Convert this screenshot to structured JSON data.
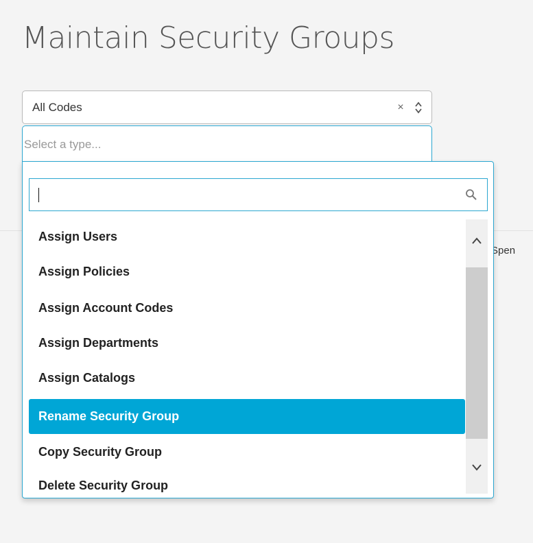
{
  "page": {
    "title": "Maintain Security Groups",
    "behind_text": "Spen"
  },
  "code_select": {
    "value": "All Codes",
    "clear_glyph": "×",
    "icons": [
      "clear-icon",
      "updown-arrows-icon"
    ]
  },
  "type_select": {
    "placeholder": "Select a type..."
  },
  "dropdown": {
    "search": {
      "value": "",
      "icon": "search-icon"
    },
    "options": [
      {
        "label": "Assign Users"
      },
      {
        "label": "Assign Policies"
      },
      {
        "label": "Assign Account Codes"
      },
      {
        "label": "Assign Departments"
      },
      {
        "label": "Assign Catalogs"
      },
      {
        "label": "Rename Security Group",
        "selected": true
      },
      {
        "label": "Copy Security Group"
      },
      {
        "label": "Delete Security Group"
      }
    ],
    "scrollbar": {
      "icons": [
        "chevron-up-icon",
        "chevron-down-icon"
      ]
    }
  },
  "colors": {
    "accent": "#00a6d6",
    "focus_border": "#2aa6d0"
  }
}
